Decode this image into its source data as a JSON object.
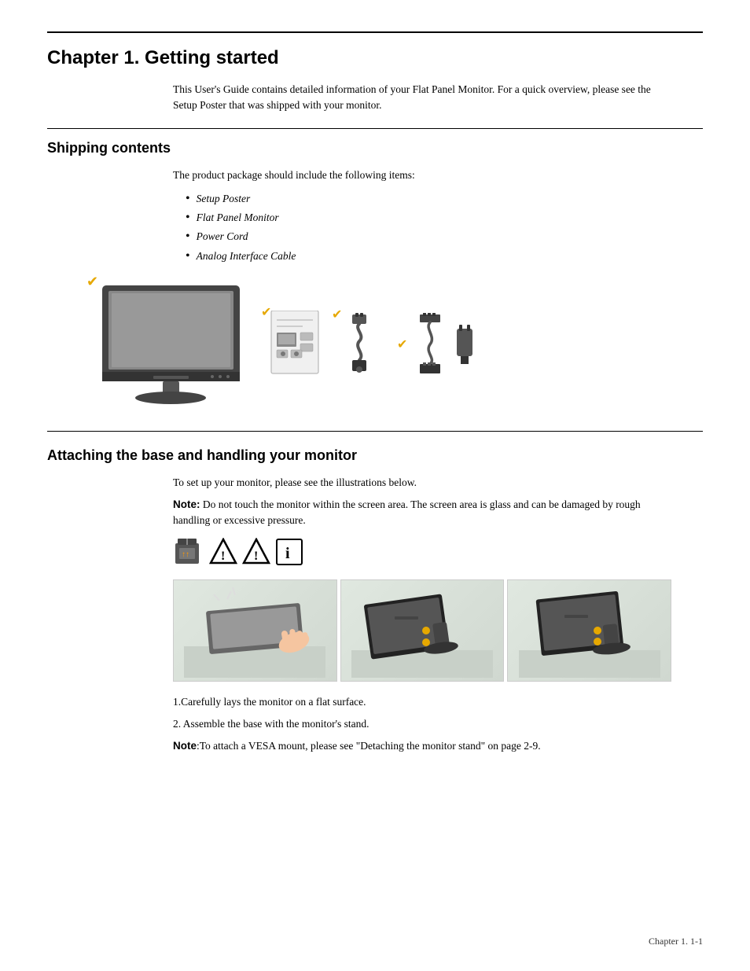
{
  "chapter": {
    "title": "Chapter 1. Getting started",
    "intro": "This User's Guide contains detailed information of your Flat Panel Monitor.  For a quick overview, please see the Setup Poster that was shipped with your monitor."
  },
  "shipping": {
    "heading": "Shipping contents",
    "intro": "The product package should include the following items:",
    "items": [
      "Setup Poster",
      "Flat Panel Monitor",
      "Power Cord",
      "Analog Interface Cable"
    ]
  },
  "attaching": {
    "heading": "Attaching the base and handling your monitor",
    "intro": "To set up your monitor, please see the illustrations below.",
    "note_label": "Note:",
    "note_text": " Do not touch the monitor within the screen area. The screen area is glass and can be damaged by rough handling or excessive pressure.",
    "steps": [
      "1.Carefully lays the monitor on a flat surface.",
      "2. Assemble the base with the monitor's stand."
    ],
    "vesa_note_label": "Note",
    "vesa_note_text": ":To attach a VESA mount, please see \"Detaching the monitor stand\" on page 2-9."
  },
  "footer": {
    "text": "Chapter 1.     1-1"
  }
}
